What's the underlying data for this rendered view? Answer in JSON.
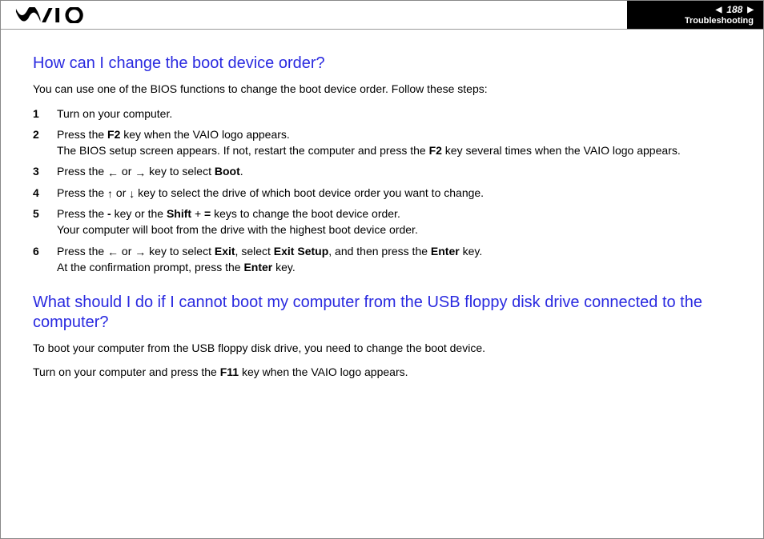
{
  "header": {
    "logo_alt": "VAIO",
    "page_number": "188",
    "breadcrumb": "Troubleshooting"
  },
  "section1": {
    "heading": "How can I change the boot device order?",
    "intro": "You can use one of the BIOS functions to change the boot device order. Follow these steps:",
    "steps": {
      "s1": "Turn on your computer.",
      "s2a": "Press the ",
      "s2b": "F2",
      "s2c": " key when the VAIO logo appears.",
      "s2d": "The BIOS setup screen appears. If not, restart the computer and press the ",
      "s2e": "F2",
      "s2f": " key several times when the VAIO logo appears.",
      "s3a": "Press the ",
      "s3b": " or ",
      "s3c": " key to select ",
      "s3d": "Boot",
      "s3e": ".",
      "s4a": "Press the ",
      "s4b": " or ",
      "s4c": " key to select the drive of which boot device order you want to change.",
      "s5a": "Press the ",
      "s5b": "-",
      "s5c": " key or the ",
      "s5d": "Shift",
      "s5e": " + ",
      "s5f": "=",
      "s5g": " keys to change the boot device order.",
      "s5h": "Your computer will boot from the drive with the highest boot device order.",
      "s6a": "Press the ",
      "s6b": " or ",
      "s6c": " key to select ",
      "s6d": "Exit",
      "s6e": ", select ",
      "s6f": "Exit Setup",
      "s6g": ", and then press the ",
      "s6h": "Enter",
      "s6i": " key.",
      "s6j": "At the confirmation prompt, press the ",
      "s6k": "Enter",
      "s6l": " key."
    }
  },
  "section2": {
    "heading": "What should I do if I cannot boot my computer from the USB floppy disk drive connected to the computer?",
    "p1": "To boot your computer from the USB floppy disk drive, you need to change the boot device.",
    "p2a": "Turn on your computer and press the ",
    "p2b": "F11",
    "p2c": " key when the VAIO logo appears."
  },
  "icons": {
    "left": "←",
    "right": "→",
    "up": "↑",
    "down": "↓",
    "tri_left": "◀",
    "tri_right": "▶"
  }
}
